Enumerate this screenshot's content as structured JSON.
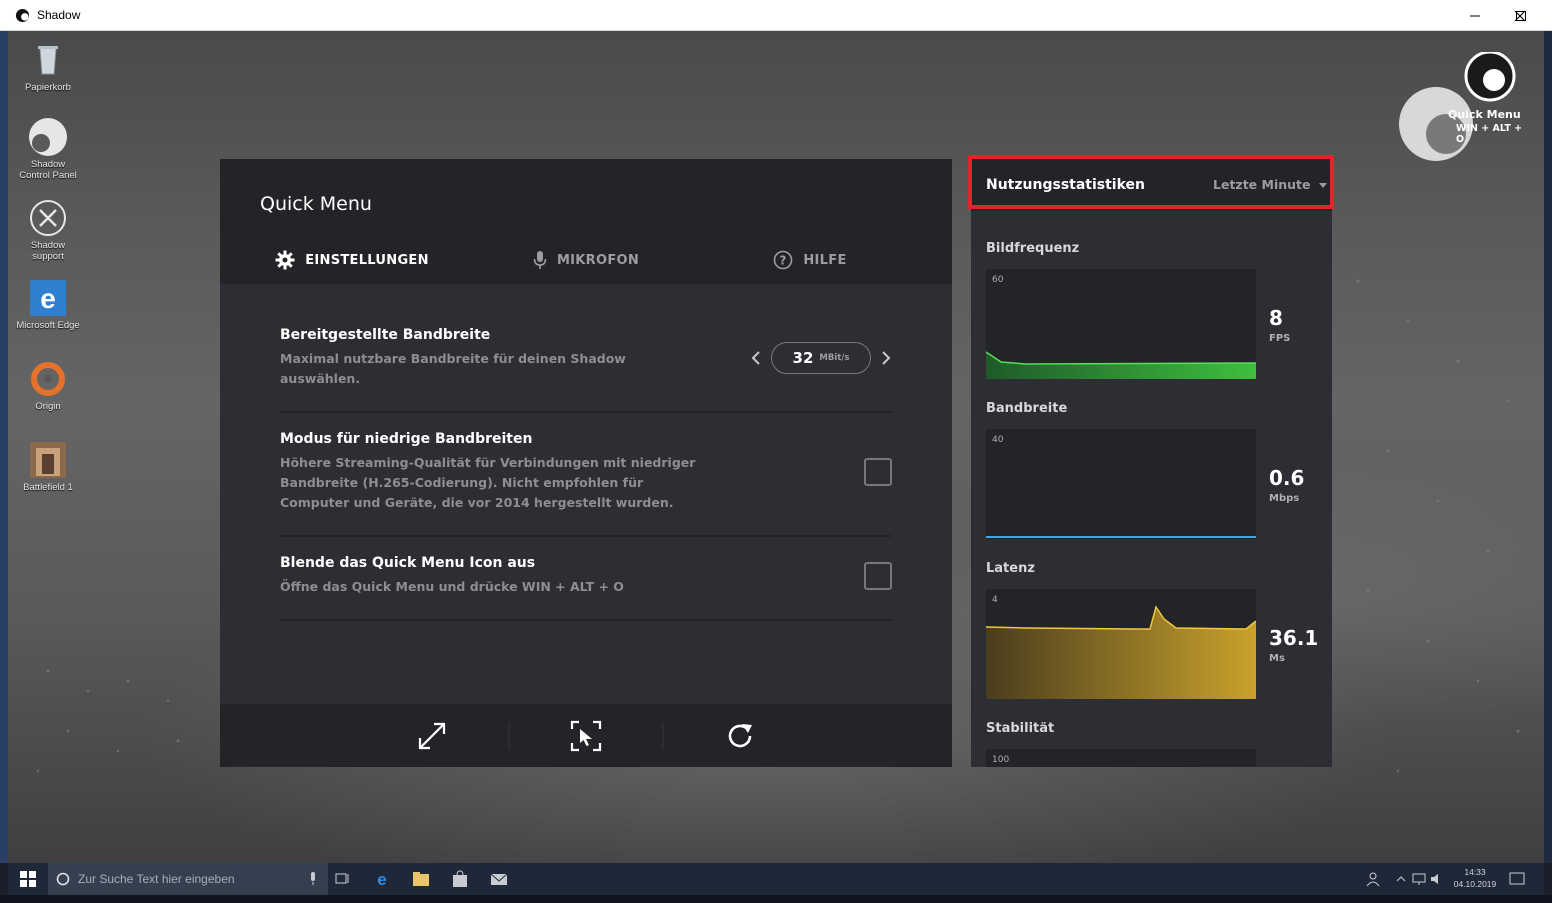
{
  "window": {
    "title": "Shadow"
  },
  "desktop_icons": [
    {
      "label": "Papierkorb"
    },
    {
      "label": "Shadow Control Panel"
    },
    {
      "label": "Shadow support"
    },
    {
      "label": "Microsoft Edge"
    },
    {
      "label": "Origin"
    },
    {
      "label": "Battlefield 1"
    }
  ],
  "quick_menu": {
    "title": "Quick Menu",
    "tabs": [
      {
        "label": "EINSTELLUNGEN",
        "icon": "gear-icon"
      },
      {
        "label": "MIKROFON",
        "icon": "microphone-icon"
      },
      {
        "label": "HILFE",
        "icon": "help-icon"
      }
    ],
    "settings": {
      "bandwidth": {
        "title": "Bereitgestellte Bandbreite",
        "description": "Maximal nutzbare Bandbreite für deinen Shadow auswählen.",
        "value": "32",
        "unit": "MBit/s"
      },
      "low_bandwidth": {
        "title": "Modus für niedrige Bandbreiten",
        "description": "Höhere Streaming-Qualität für Verbindungen mit niedriger Bandbreite (H.265-Codierung). Nicht empfohlen für Computer und Geräte, die vor 2014 hergestellt wurden.",
        "checked": false
      },
      "hide_icon": {
        "title": "Blende das Quick Menu Icon aus",
        "description": "Öffne das Quick Menu und drücke WIN + ALT + O",
        "checked": false
      }
    },
    "footer_icons": [
      "fullscreen-icon",
      "cursor-capture-icon",
      "refresh-icon"
    ]
  },
  "stats": {
    "title": "Nutzungsstatistiken",
    "period": "Letzte Minute",
    "metrics": [
      {
        "label": "Bildfrequenz",
        "max_tick": "60",
        "value": "8",
        "unit": "FPS",
        "color": "#3fbf3f"
      },
      {
        "label": "Bandbreite",
        "max_tick": "40",
        "value": "0.6",
        "unit": "Mbps",
        "color": "#3fa8e0"
      },
      {
        "label": "Latenz",
        "max_tick": "4",
        "value": "36.1",
        "unit": "Ms",
        "color": "#e0b62c"
      },
      {
        "label": "Stabilität",
        "max_tick": "100"
      }
    ]
  },
  "overlay": {
    "label": "Quick Menu",
    "shortcut": "WIN + ALT + O"
  },
  "taskbar": {
    "search_placeholder": "Zur Suche Text hier eingeben",
    "time": "14:33",
    "date": "04.10.2019"
  }
}
